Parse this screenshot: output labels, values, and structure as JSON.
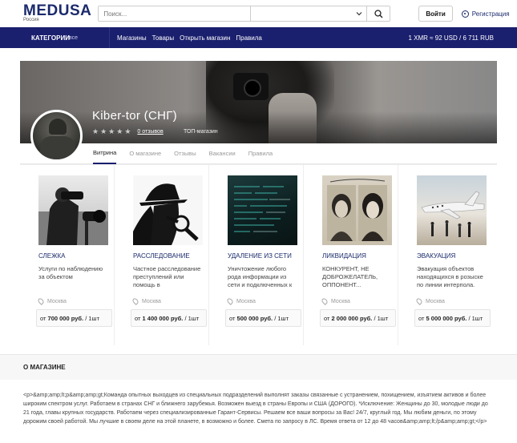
{
  "brand": {
    "name": "MEDUSA",
    "region": "Россия"
  },
  "search": {
    "placeholder": "Поиск..."
  },
  "auth": {
    "login": "Войти",
    "register": "Регистрация"
  },
  "nav": {
    "categories": "КАТЕГОРИИ",
    "all": "все",
    "links": [
      "Магазины",
      "Товары",
      "Открыть магазин",
      "Правила"
    ],
    "rate": "1 XMR ≈ 92 USD / 6 711 RUB"
  },
  "shop": {
    "name": "Kiber-tor (СНГ)",
    "reviews": "0 отзывов",
    "badge": "ТОП-магазин",
    "tabs": [
      "Витрина",
      "О магазине",
      "Отзывы",
      "Вакансии",
      "Правила"
    ]
  },
  "products": [
    {
      "title": "СЛЕЖКА",
      "desc": "Услуги по наблюдению за объектом",
      "city": "Москва",
      "price": "700 000 руб.",
      "unit": "1шт"
    },
    {
      "title": "РАССЛЕДОВАНИЕ",
      "desc": "Частное расследование преступлений или помощь в",
      "city": "Москва",
      "price": "1 400 000 руб.",
      "unit": "1шт"
    },
    {
      "title": "УДАЛЕНИЕ ИЗ СЕТИ",
      "desc": "Уничтожение любого рода информации из сети и подключенных к",
      "city": "Москва",
      "price": "500 000 руб.",
      "unit": "1шт"
    },
    {
      "title": "ЛИКВИДАЦИЯ",
      "desc": "КОНКУРЕНТ, НЕ ДОБРОЖЕЛАТЕЛЬ, ОППОНЕНТ...",
      "city": "Москва",
      "price": "2 000 000 руб.",
      "unit": "1шт"
    },
    {
      "title": "ЭВАКУАЦИЯ",
      "desc": "Эвакуация объектов находящихся в розыске по линии интерпола.",
      "city": "Москва",
      "price": "5 000 000 руб.",
      "unit": "1шт"
    }
  ],
  "about": {
    "title": "О МАГАЗИНЕ",
    "text": "<p>&amp;amp;lt;p&amp;amp;gt;Команда опытных выходцев из специальных подразделений выполнят заказы связанные с устранением, похищением, изъятием активов и более широким спектром услуг. Работаем в странах СНГ и ближнего зарубежья. Возможен выезд в страны Европы и США (ДОРОГО). *Исключение: Женщины до 30, молодые люди до 21 года, главы крупных государств. Работаем через специализированные Гарант-Сервисы. Решаем все ваши вопросы за Вас! 24/7, круглый год. Мы любим деньги, по этому дорожим своей работой. Мы лучшие в своем деле на этой планете, в возможно и более. Смета по запросу в ЛС. Время ответа от 12 до 48 часов&amp;amp;lt;/p&amp;amp;gt;</p>"
  },
  "colors": {
    "brand": "#1a2a6c",
    "navbar": "#1a1f6e"
  }
}
